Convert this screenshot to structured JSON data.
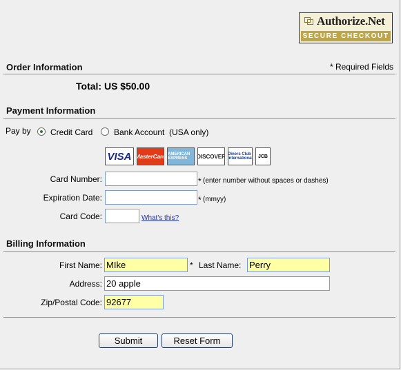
{
  "logo": {
    "name": "Authorize.Net",
    "tagline": "SECURE CHECKOUT"
  },
  "order": {
    "title": "Order Information",
    "required_note": "* Required Fields",
    "total_label": "Total:",
    "total_value": "US $50.00"
  },
  "payment": {
    "title": "Payment Information",
    "pay_by_label": "Pay by",
    "options": [
      {
        "label": "Credit Card",
        "checked": true
      },
      {
        "label": "Bank Account  (USA only)",
        "checked": false
      }
    ],
    "cards": [
      "VISA",
      "MasterCard",
      "AMERICAN EXPRESS",
      "DISCOVER",
      "Diners Club International",
      "JCB"
    ],
    "card_number_label": "Card Number:",
    "card_number_value": "",
    "card_number_hint": "(enter number without spaces or dashes)",
    "expiration_label": "Expiration Date:",
    "expiration_value": "",
    "expiration_hint": "(mmyy)",
    "card_code_label": "Card Code:",
    "card_code_value": "",
    "whats_this": "What's this?",
    "star": "*"
  },
  "billing": {
    "title": "Billing Information",
    "first_name_label": "First Name:",
    "first_name_value": "MIke",
    "last_name_label": "Last Name:",
    "last_name_value": "Perry",
    "address_label": "Address:",
    "address_value": "20 apple",
    "zip_label": "Zip/Postal Code:",
    "zip_value": "92677",
    "star": "*"
  },
  "actions": {
    "submit": "Submit",
    "reset": "Reset Form"
  },
  "colors": {
    "highlight": "#ffffa6",
    "logo_bar": "#bda648",
    "background": "#efefef"
  }
}
